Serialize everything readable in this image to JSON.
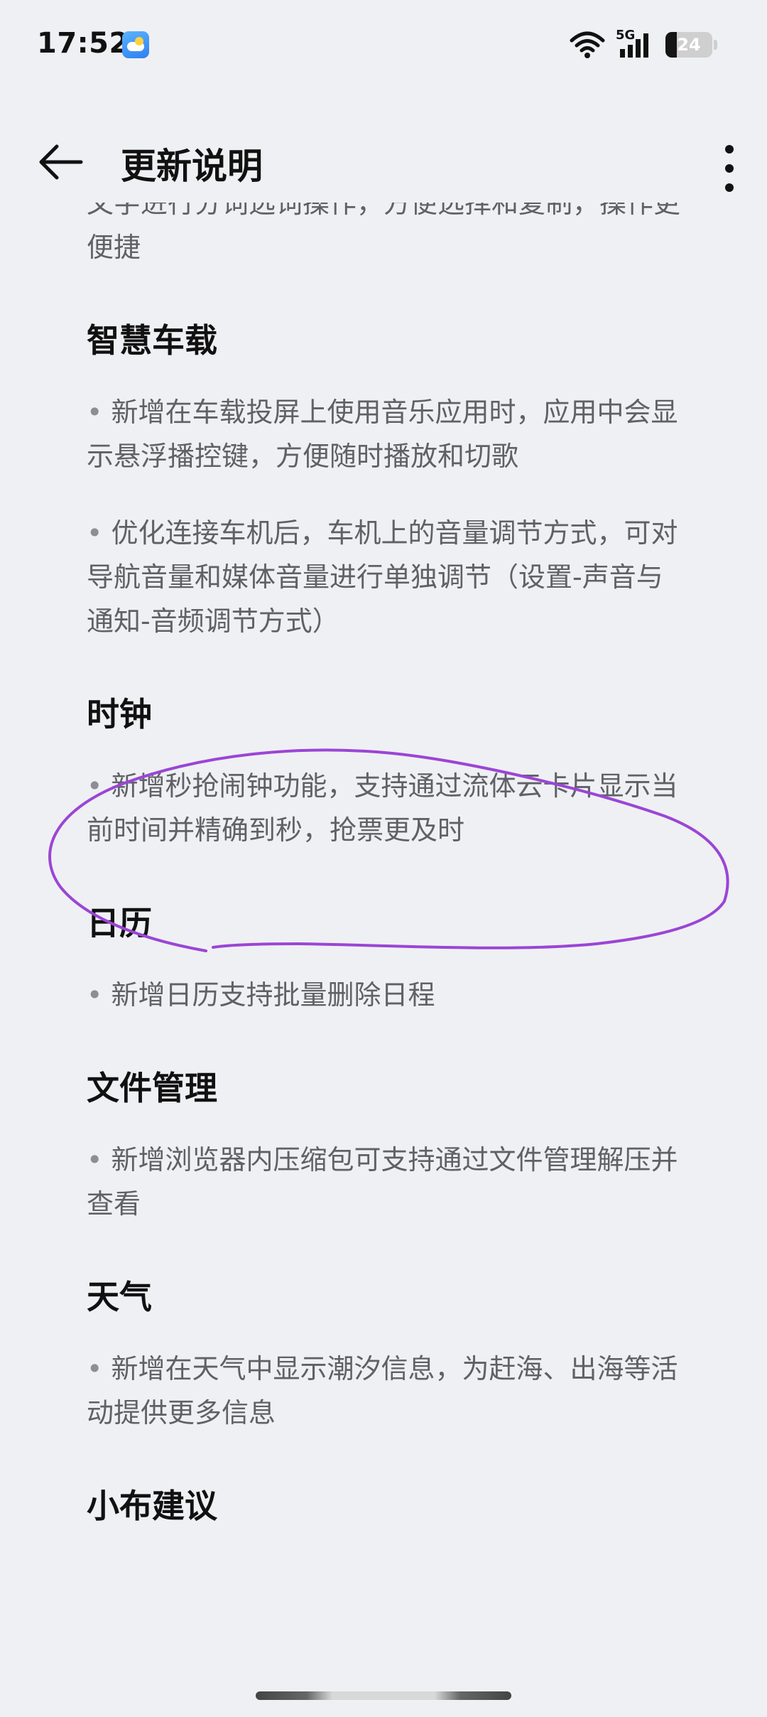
{
  "status_bar": {
    "time": "17:52",
    "weather_icon": "weather-cloud-icon",
    "network": "5G",
    "battery_text": "24",
    "battery_level": 0.24
  },
  "header": {
    "title": "更新说明",
    "back_icon": "back-arrow-icon",
    "more_icon": "more-vertical-icon"
  },
  "intro_fragment": "文字进行分词选词操作，方便选择和复制，操作更便捷",
  "sections": [
    {
      "title": "智慧车载",
      "items": [
        "新增在车载投屏上使用音乐应用时，应用中会显示悬浮播控键，方便随时播放和切歌",
        "优化连接车机后，车机上的音量调节方式，可对导航音量和媒体音量进行单独调节（设置-声音与通知-音频调节方式）"
      ]
    },
    {
      "title": "时钟",
      "items": [
        "新增秒抢闹钟功能，支持通过流体云卡片显示当前时间并精确到秒，抢票更及时"
      ]
    },
    {
      "title": "日历",
      "items": [
        "新增日历支持批量删除日程"
      ]
    },
    {
      "title": "文件管理",
      "items": [
        "新增浏览器内压缩包可支持通过文件管理解压并查看"
      ]
    },
    {
      "title": "天气",
      "items": [
        "新增在天气中显示潮汐信息，为赶海、出海等活动提供更多信息"
      ]
    },
    {
      "title": "小布建议",
      "items": []
    }
  ],
  "bullet": "•",
  "annotation_color": "#9b45d6",
  "colors": {
    "background": "#eff0f3",
    "title_text": "#111111",
    "body_text": "#5f6166"
  }
}
